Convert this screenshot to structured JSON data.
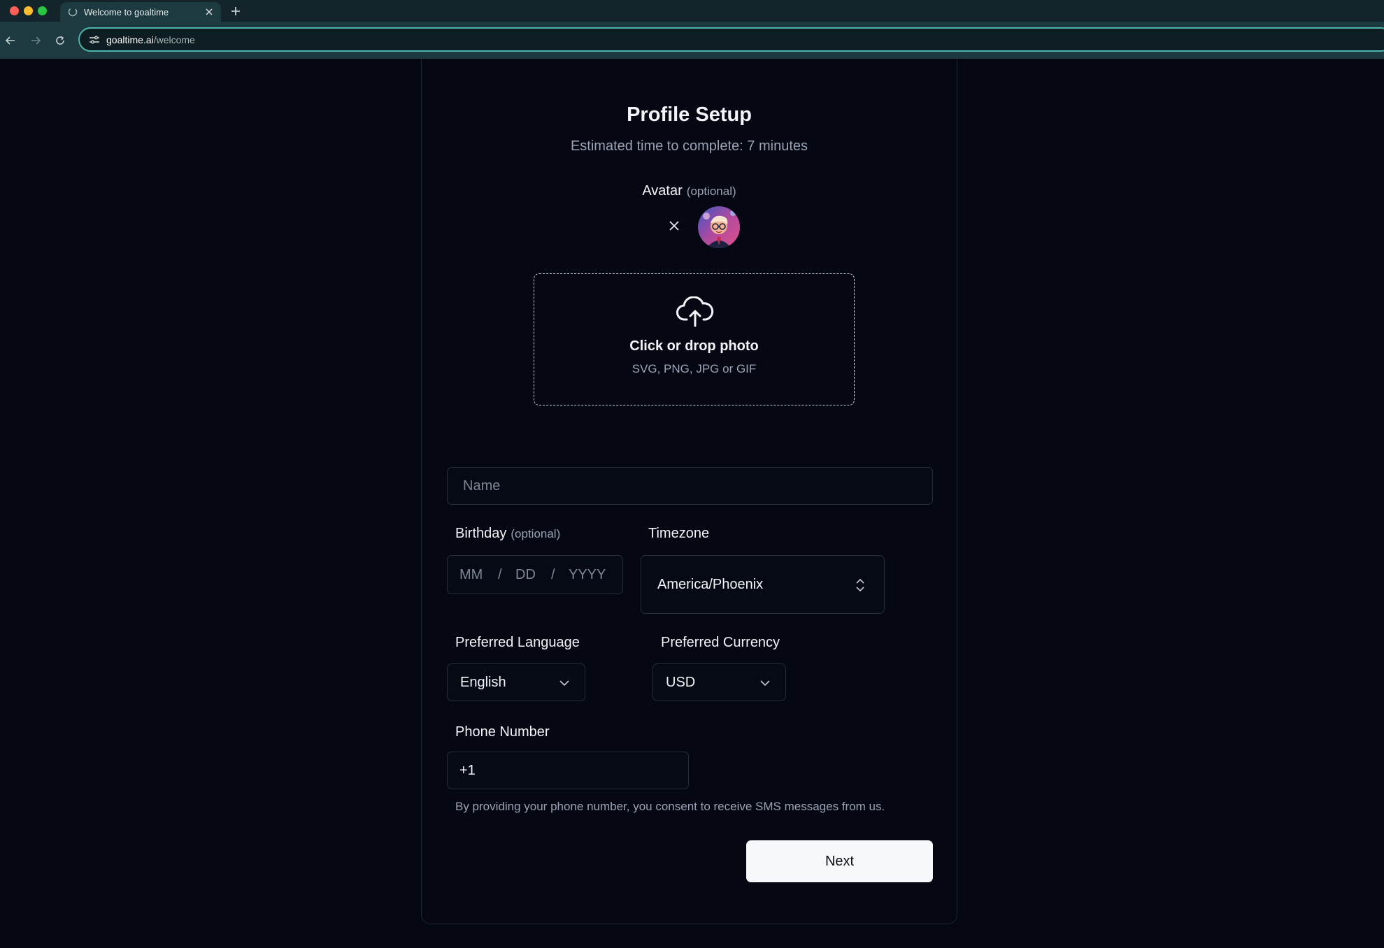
{
  "browser": {
    "tab_title": "Welcome to goaltime",
    "url_host": "goaltime.ai",
    "url_path": "/welcome"
  },
  "page": {
    "title": "Profile Setup",
    "subtitle": "Estimated time to complete: 7 minutes"
  },
  "avatar": {
    "label": "Avatar",
    "optional_label": "(optional)"
  },
  "upload": {
    "title": "Click or drop photo",
    "formats": "SVG, PNG, JPG or GIF"
  },
  "name": {
    "placeholder": "Name",
    "value": ""
  },
  "birthday": {
    "label": "Birthday",
    "optional_label": "(optional)",
    "month_placeholder": "MM",
    "day_placeholder": "DD",
    "year_placeholder": "YYYY",
    "separator": "/"
  },
  "timezone": {
    "label": "Timezone",
    "value": "America/Phoenix"
  },
  "language": {
    "label": "Preferred Language",
    "value": "English"
  },
  "currency": {
    "label": "Preferred Currency",
    "value": "USD"
  },
  "phone": {
    "label": "Phone Number",
    "value": "+1",
    "consent": "By providing your phone number, you consent to receive SMS messages from us."
  },
  "actions": {
    "next_label": "Next"
  },
  "colors": {
    "background": "#050812",
    "chrome_accent": "#4db6ac",
    "button_bg": "#f7f8fa"
  }
}
